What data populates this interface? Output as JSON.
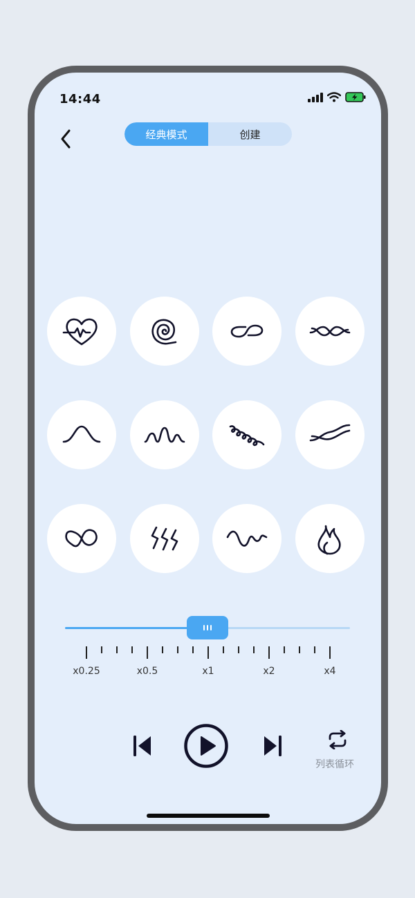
{
  "status_bar": {
    "time": "14:44"
  },
  "header": {
    "tabs": [
      {
        "label": "经典模式",
        "active": true
      },
      {
        "label": "创建",
        "active": false
      }
    ]
  },
  "patterns": [
    {
      "icon": "heartbeat-heart-icon"
    },
    {
      "icon": "spiral-icon"
    },
    {
      "icon": "infinity-loop-icon"
    },
    {
      "icon": "twisted-wave-icon"
    },
    {
      "icon": "bell-curve-icon"
    },
    {
      "icon": "squiggle-wave-icon"
    },
    {
      "icon": "coil-loops-icon"
    },
    {
      "icon": "double-wave-icon"
    },
    {
      "icon": "heart-infinity-icon"
    },
    {
      "icon": "zigzag-bolts-icon"
    },
    {
      "icon": "loop-wave-icon"
    },
    {
      "icon": "flame-icon"
    }
  ],
  "speed_slider": {
    "value": "x1",
    "labels": [
      "x0.25",
      "x0.5",
      "x1",
      "x2",
      "x4"
    ]
  },
  "controls": {
    "loop_label": "列表循环"
  },
  "colors": {
    "accent": "#4aa7f2",
    "background": "#e4eefb",
    "icon": "#12122a"
  }
}
